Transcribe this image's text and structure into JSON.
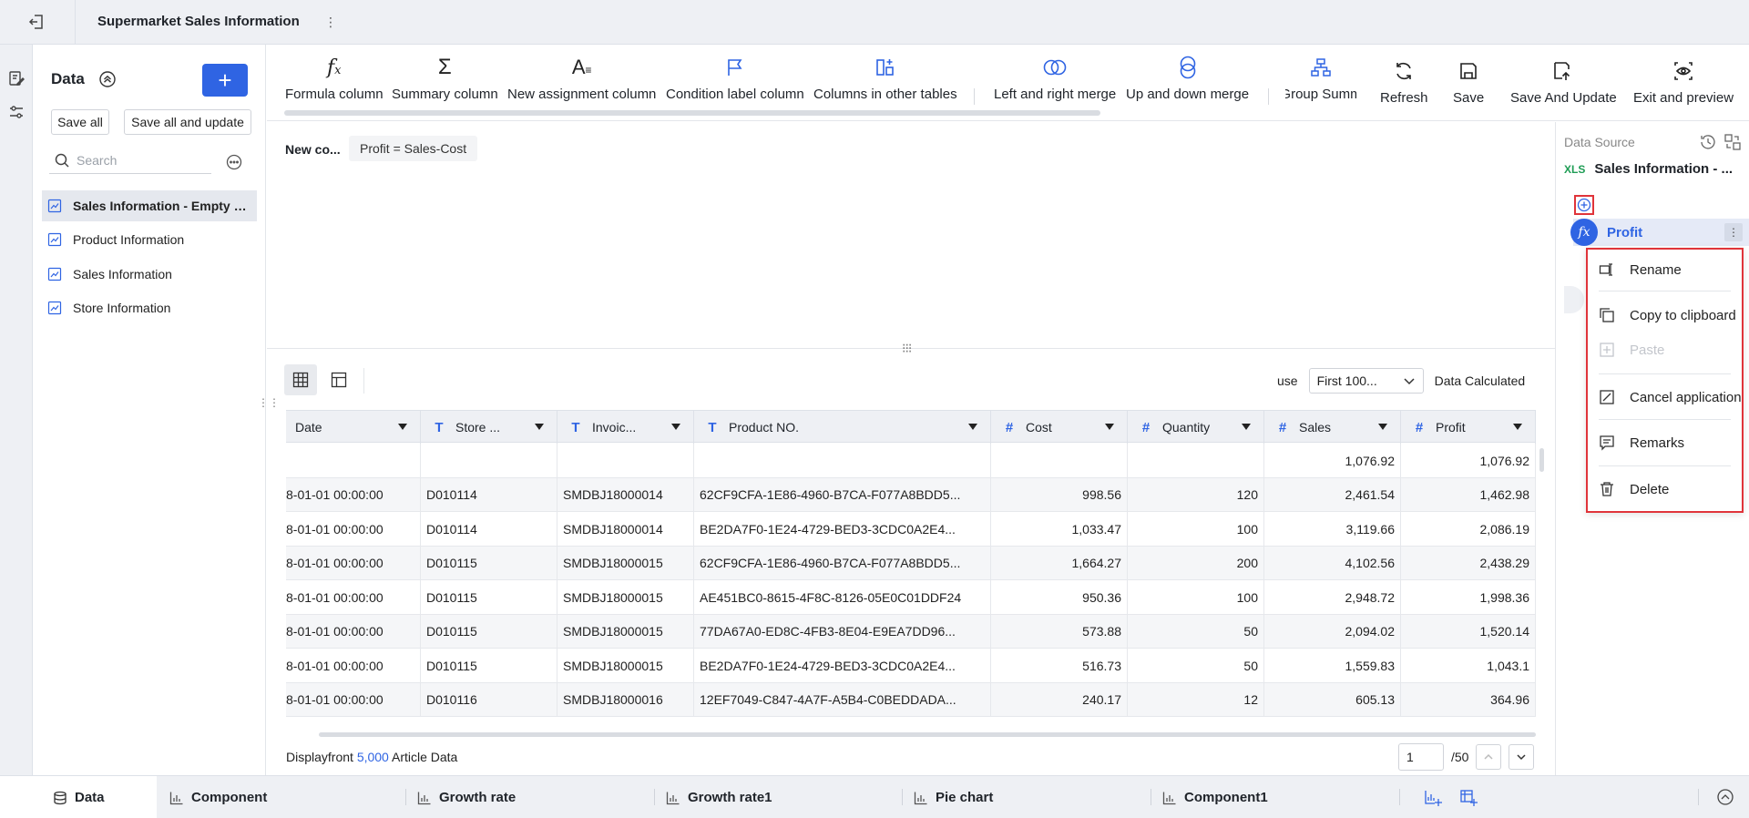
{
  "header": {
    "title": "Supermarket Sales Information"
  },
  "left_panel": {
    "heading": "Data",
    "save_all": "Save all",
    "save_all_update": "Save all and update",
    "search_placeholder": "Search",
    "items": [
      {
        "label": "Sales Information - Empty Set"
      },
      {
        "label": "Product Information"
      },
      {
        "label": "Sales Information"
      },
      {
        "label": "Store Information"
      }
    ]
  },
  "toolbar": {
    "formula_column": "Formula column",
    "summary_column": "Summary column",
    "new_assignment_column": "New assignment column",
    "condition_label_column": "Condition label column",
    "columns_in_other_tables": "Columns in other tables",
    "left_right_merge": "Left and right merge",
    "up_down_merge": "Up and down merge",
    "group_summary": "Group Summ",
    "refresh": "Refresh",
    "save": "Save",
    "save_and_update": "Save And Update",
    "exit_and_preview": "Exit and preview"
  },
  "formula": {
    "label": "New co...",
    "expression": "Profit = Sales-Cost"
  },
  "view": {
    "use_label": "use",
    "selected_option": "First 100...",
    "data_calculated": "Data Calculated"
  },
  "table": {
    "columns": [
      {
        "label": "Date",
        "type": ""
      },
      {
        "label": "Store ...",
        "type": "T"
      },
      {
        "label": "Invoic...",
        "type": "T"
      },
      {
        "label": "Product NO.",
        "type": "T"
      },
      {
        "label": "Cost",
        "type": "#"
      },
      {
        "label": "Quantity",
        "type": "#"
      },
      {
        "label": "Sales",
        "type": "#"
      },
      {
        "label": "Profit",
        "type": "#"
      }
    ],
    "summary_row": [
      "",
      "",
      "",
      "",
      "",
      "",
      "1,076.92",
      "1,076.92"
    ],
    "rows": [
      [
        "8-01-01 00:00:00",
        "D010114",
        "SMDBJ18000014",
        "62CF9CFA-1E86-4960-B7CA-F077A8BDD5...",
        "998.56",
        "120",
        "2,461.54",
        "1,462.98"
      ],
      [
        "8-01-01 00:00:00",
        "D010114",
        "SMDBJ18000014",
        "BE2DA7F0-1E24-4729-BED3-3CDC0A2E4...",
        "1,033.47",
        "100",
        "3,119.66",
        "2,086.19"
      ],
      [
        "8-01-01 00:00:00",
        "D010115",
        "SMDBJ18000015",
        "62CF9CFA-1E86-4960-B7CA-F077A8BDD5...",
        "1,664.27",
        "200",
        "4,102.56",
        "2,438.29"
      ],
      [
        "8-01-01 00:00:00",
        "D010115",
        "SMDBJ18000015",
        "AE451BC0-8615-4F8C-8126-05E0C01DDF24",
        "950.36",
        "100",
        "2,948.72",
        "1,998.36"
      ],
      [
        "8-01-01 00:00:00",
        "D010115",
        "SMDBJ18000015",
        "77DA67A0-ED8C-4FB3-8E04-E9EA7DD96...",
        "573.88",
        "50",
        "2,094.02",
        "1,520.14"
      ],
      [
        "8-01-01 00:00:00",
        "D010115",
        "SMDBJ18000015",
        "BE2DA7F0-1E24-4729-BED3-3CDC0A2E4...",
        "516.73",
        "50",
        "1,559.83",
        "1,043.1"
      ],
      [
        "8-01-01 00:00:00",
        "D010116",
        "SMDBJ18000016",
        "12EF7049-C847-4A7F-A5B4-C0BEDDADA...",
        "240.17",
        "12",
        "605.13",
        "364.96"
      ]
    ]
  },
  "footer": {
    "prefix": "Displayfront",
    "count": "5,000",
    "suffix": "Article Data",
    "page": "1",
    "total": "/50"
  },
  "right_panel": {
    "data_source_label": "Data Source",
    "source_name": "Sales Information - ...",
    "xls_label": "XLS",
    "field_name": "Profit",
    "field_badge": "fx"
  },
  "context_menu": {
    "rename": "Rename",
    "copy": "Copy to clipboard",
    "paste": "Paste",
    "cancel": "Cancel application",
    "remarks": "Remarks",
    "delete": "Delete"
  },
  "tabs": [
    {
      "label": "Data"
    },
    {
      "label": "Component"
    },
    {
      "label": "Growth rate"
    },
    {
      "label": "Growth rate1"
    },
    {
      "label": "Pie chart"
    },
    {
      "label": "Component1"
    }
  ],
  "colors": {
    "accent": "#2f64e3",
    "highlight_border": "#e0343a",
    "xls_green": "#1f9d55"
  }
}
